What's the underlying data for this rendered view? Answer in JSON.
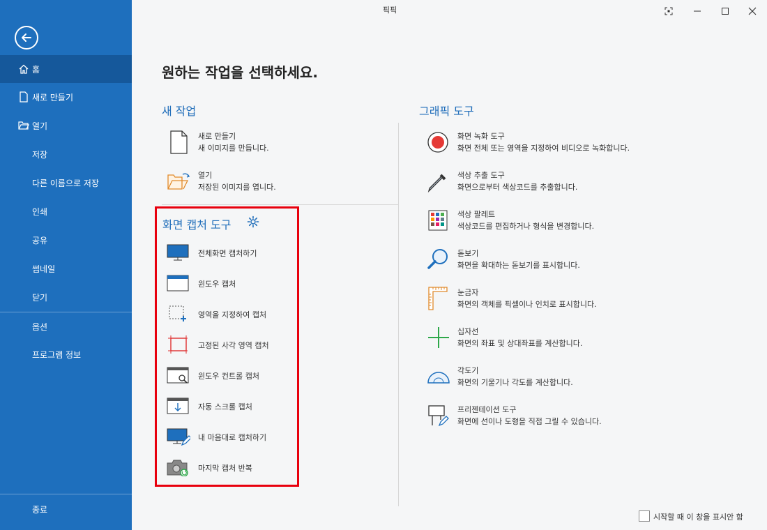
{
  "window": {
    "title": "픽픽"
  },
  "sidebar": {
    "home": "홈",
    "new": "새로 만들기",
    "open": "열기",
    "save": "저장",
    "save_as": "다른 이름으로 저장",
    "print": "인쇄",
    "share": "공유",
    "thumbnail": "썸네일",
    "close": "닫기",
    "options": "옵션",
    "about": "프로그램 정보",
    "exit": "종료"
  },
  "main": {
    "heading": "원하는 작업을 선택하세요.",
    "new_task": {
      "heading": "새 작업",
      "items": [
        {
          "title": "새로 만들기",
          "desc": "새 이미지를 만듭니다."
        },
        {
          "title": "열기",
          "desc": "저장된 이미지를 엽니다."
        }
      ]
    },
    "capture": {
      "heading": "화면 캡처 도구",
      "items": [
        {
          "label": "전체화면 캡처하기"
        },
        {
          "label": "윈도우 캡처"
        },
        {
          "label": "영역을 지정하여 캡처"
        },
        {
          "label": "고정된 사각 영역 캡처"
        },
        {
          "label": "윈도우 컨트롤 캡처"
        },
        {
          "label": "자동 스크롤 캡처"
        },
        {
          "label": "내 마음대로 캡처하기"
        },
        {
          "label": "마지막 캡처 반복"
        }
      ]
    },
    "graphics": {
      "heading": "그래픽 도구",
      "items": [
        {
          "title": "화면 녹화 도구",
          "desc": "화면 전체 또는 영역을 지정하여 비디오로 녹화합니다."
        },
        {
          "title": "색상 추출 도구",
          "desc": "화면으로부터 색상코드를 추출합니다."
        },
        {
          "title": "색상 팔레트",
          "desc": "색상코드를 편집하거나 형식을 변경합니다."
        },
        {
          "title": "돋보기",
          "desc": "화면을 확대하는 돋보기를 표시합니다."
        },
        {
          "title": "눈금자",
          "desc": "화면의 객체를 픽셀이나 인치로 표시합니다."
        },
        {
          "title": "십자선",
          "desc": "화면의 좌표 및 상대좌표를 계산합니다."
        },
        {
          "title": "각도기",
          "desc": "화면의 기울기나 각도를 계산합니다."
        },
        {
          "title": "프리젠테이션 도구",
          "desc": "화면에 선이나 도형을 직접 그릴 수 있습니다."
        }
      ]
    }
  },
  "footer": {
    "dont_show": "시작할 때 이 창을 표시안 함"
  },
  "colors": {
    "sidebar": "#1e6fbd",
    "sidebar_active": "#15589b",
    "accent": "#1f6dba",
    "highlight": "#e8000d"
  }
}
